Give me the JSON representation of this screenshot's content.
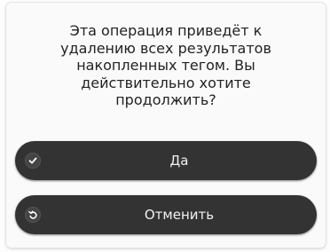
{
  "dialog": {
    "message_lines": [
      "Эта операция приведёт к",
      "удалению всех результатов",
      "накопленных тегом. Вы",
      "действительно хотите",
      "продолжить?"
    ],
    "buttons": {
      "confirm": {
        "label": "Да",
        "icon": "check-icon"
      },
      "cancel": {
        "label": "Отменить",
        "icon": "undo-icon"
      }
    }
  },
  "colors": {
    "dialog_bg": "#fafafa",
    "button_bg": "#333333",
    "button_text": "#f2f2f2",
    "message_text": "#222222"
  }
}
